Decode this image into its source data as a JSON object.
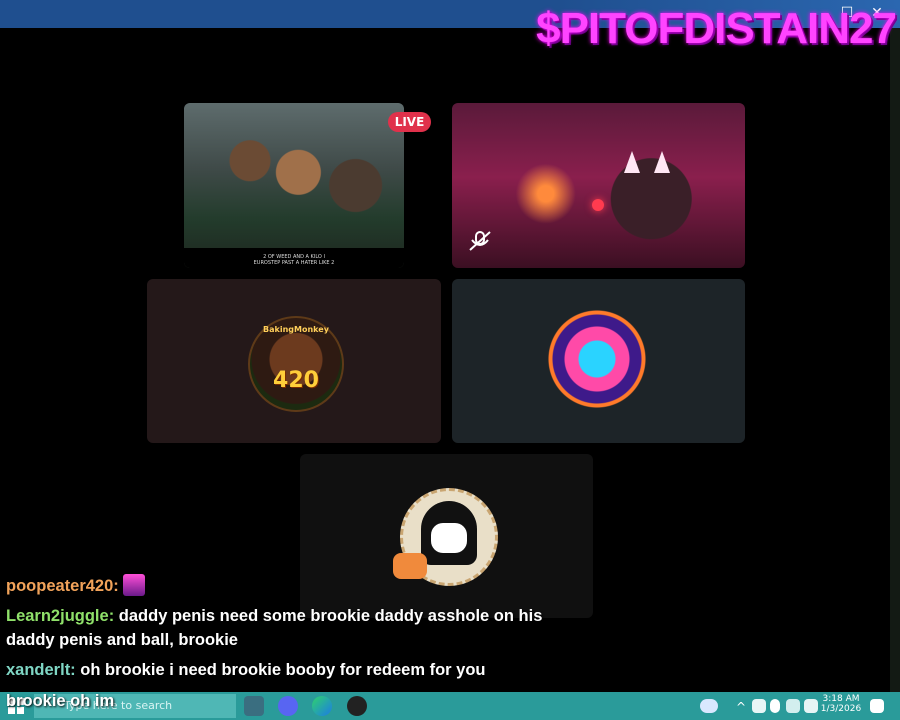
{
  "overlay": {
    "channel_name": "$PITOFDISTAIN27"
  },
  "window_controls": {
    "maximize": "☐",
    "close": "✕"
  },
  "tiles": {
    "screenshare": {
      "caption_line1": "2 OF WEED AND A KILO I",
      "caption_line2": "EUROSTEP PAST A HATER LIKE 2"
    },
    "live_badge": "LIVE",
    "monkey_avatar": {
      "top_text": "BakingMonkey",
      "number": "420"
    }
  },
  "chat": [
    {
      "user": "poopeater420:",
      "message": ""
    },
    {
      "user": "Learn2juggle:",
      "message": "daddy penis need some brookie daddy asshole on his daddy penis and ball, brookie"
    },
    {
      "user": "xanderlt:",
      "message": "oh brookie i need brookie booby for redeem for you"
    }
  ],
  "chat_bottom": "brookie oh im",
  "taskbar": {
    "search_placeholder": "Type here to search",
    "time": "3:18 AM",
    "date": "1/3/2026"
  },
  "colors": {
    "titlebar": "#1f4f8f",
    "taskbar": "#2a9b9a",
    "live": "#e0314b",
    "overlay": "#ff44ff"
  }
}
